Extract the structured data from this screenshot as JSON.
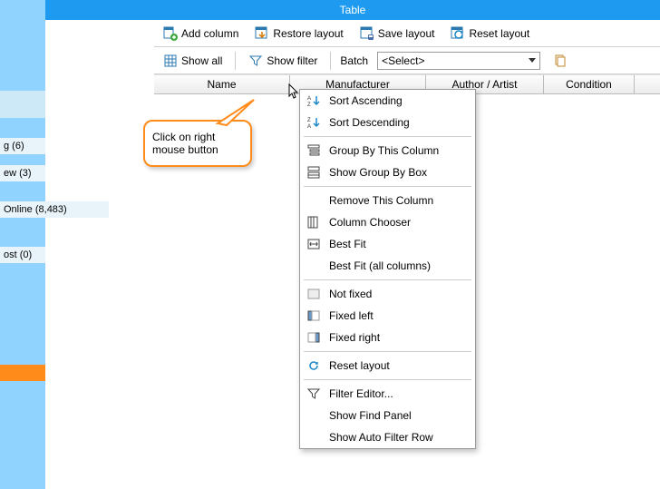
{
  "title": "Table",
  "toolbar1": {
    "add_column": "Add column",
    "restore_layout": "Restore layout",
    "save_layout": "Save layout",
    "reset_layout": "Reset layout"
  },
  "toolbar2": {
    "show_all": "Show all",
    "show_filter": "Show filter",
    "batch_label": "Batch",
    "batch_value": "<Select>"
  },
  "headers": {
    "name": "Name",
    "manufacturer": "Manufacturer",
    "author": "Author / Artist",
    "condition": "Condition"
  },
  "sidebar": {
    "items": [
      "g (6)",
      "ew (3)",
      "Online (8,483)",
      "ost (0)"
    ]
  },
  "callout": {
    "text": "Click on right mouse button"
  },
  "context_menu": {
    "sort_asc": "Sort Ascending",
    "sort_desc": "Sort Descending",
    "group_by": "Group By This Column",
    "show_group_box": "Show Group By Box",
    "remove_col": "Remove This Column",
    "column_chooser": "Column Chooser",
    "best_fit": "Best Fit",
    "best_fit_all": "Best Fit (all columns)",
    "not_fixed": "Not fixed",
    "fixed_left": "Fixed left",
    "fixed_right": "Fixed right",
    "reset_layout": "Reset layout",
    "filter_editor": "Filter Editor...",
    "show_find": "Show Find Panel",
    "show_auto_filter": "Show Auto Filter Row"
  }
}
